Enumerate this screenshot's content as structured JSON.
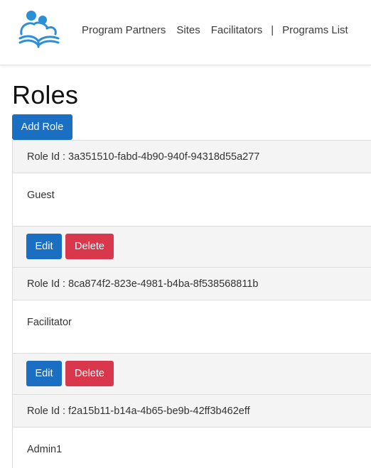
{
  "nav": {
    "links": [
      "Program Partners",
      "Sites",
      "Facilitators",
      "|",
      "Programs List"
    ]
  },
  "page": {
    "title": "Roles",
    "add_button": "Add Role"
  },
  "roles": [
    {
      "id_label": "Role Id : 3a351510-fabd-4b90-940f-94318d55a277",
      "name": "Guest",
      "edit": "Edit",
      "delete": "Delete"
    },
    {
      "id_label": "Role Id : 8ca874f2-823e-4981-b4ba-8f538568811b",
      "name": "Facilitator",
      "edit": "Edit",
      "delete": "Delete"
    },
    {
      "id_label": "Role Id : f2a15b11-b14a-4b65-be9b-42ff3b462eff",
      "name": "Admin1"
    }
  ],
  "colors": {
    "primary": "#1a6fc2",
    "danger": "#d9384c",
    "logo": "#2a8fd6"
  }
}
